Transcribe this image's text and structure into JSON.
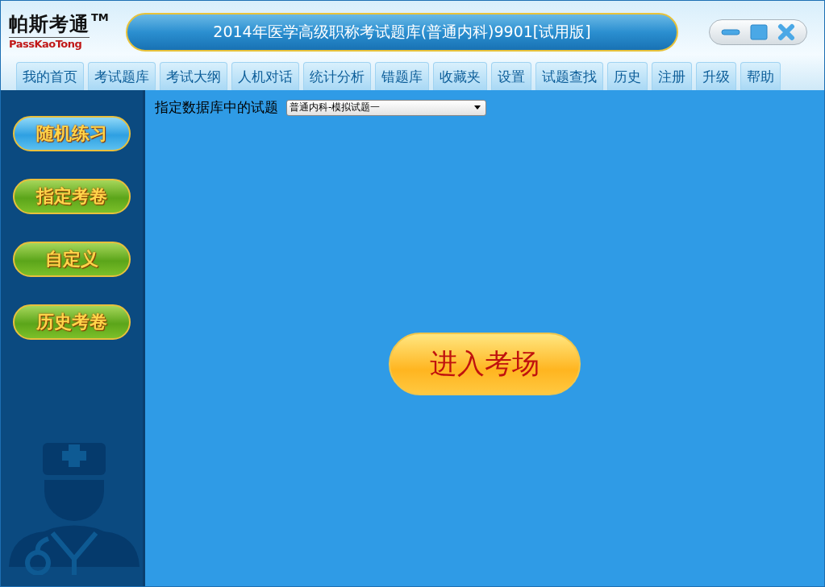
{
  "logo": {
    "name": "帕斯考通",
    "trademark": "TM",
    "latin": "PassKaoTong"
  },
  "window": {
    "title": "2014年医学高级职称考试题库(普通内科)9901[试用版]"
  },
  "tabs": [
    {
      "label": "我的首页"
    },
    {
      "label": "考试题库"
    },
    {
      "label": "考试大纲"
    },
    {
      "label": "人机对话"
    },
    {
      "label": "统计分析"
    },
    {
      "label": "错题库"
    },
    {
      "label": "收藏夹"
    },
    {
      "label": "设置"
    },
    {
      "label": "试题查找"
    },
    {
      "label": "历史"
    },
    {
      "label": "注册"
    },
    {
      "label": "升级"
    },
    {
      "label": "帮助"
    }
  ],
  "sidebar": {
    "items": [
      {
        "label": "随机练习",
        "selected": true
      },
      {
        "label": "指定考卷",
        "selected": false
      },
      {
        "label": "自定义",
        "selected": false
      },
      {
        "label": "历史考卷",
        "selected": false
      }
    ]
  },
  "database": {
    "label": "指定数据库中的试题",
    "value": "普通内科-模拟试题一"
  },
  "enter_button": {
    "label": "进入考场"
  }
}
